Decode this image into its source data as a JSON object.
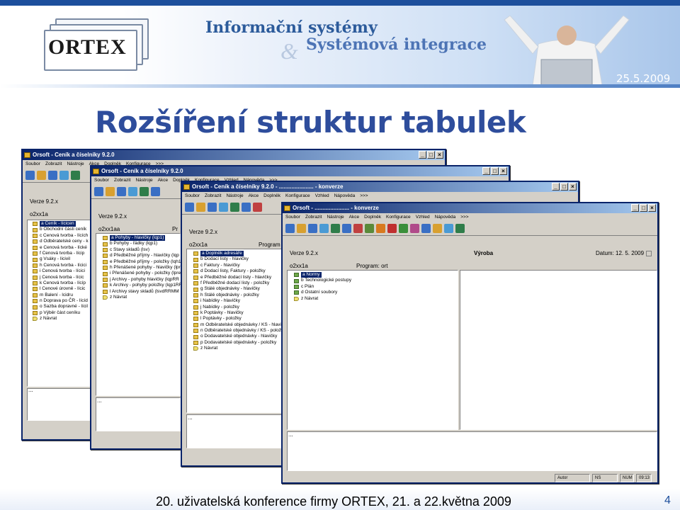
{
  "banner": {
    "logo": "ORTEX",
    "org_line1": "Informační systémy",
    "org_amp": "&",
    "org_line2": "Systémová integrace",
    "date": "25.5.2009"
  },
  "slide": {
    "title": "Rozšíření struktur tabulek",
    "footer": "20. uživatelská konference firmy ORTEX, 21. a 22.května 2009",
    "page_number": "4"
  },
  "colors": {
    "accent": "#2e4d9c",
    "titlebar": "#0a246a",
    "selection": "#0a246a"
  },
  "windows": [
    {
      "title": "Orsoft - Ceník a číselníky 9.2.0",
      "menu": [
        "Soubor",
        "Zobrazit",
        "Nástroje",
        "Akce",
        "Doplněk",
        "Konfigurace",
        ">>>"
      ],
      "version": "Verze 9.2.x",
      "user": "o2xx1a",
      "tree": [
        {
          "text": "a  Ceník - lícicen",
          "selected": true
        },
        {
          "text": "b  Obchodní části ceník"
        },
        {
          "text": "c  Cenová tvorba - lících"
        },
        {
          "text": "d  Odběratelské ceny - k"
        },
        {
          "text": "e  Cenová tvorba - lícké"
        },
        {
          "text": "f  Cenová tvorba - lícip"
        },
        {
          "text": "g  Vsáky - lícivil"
        },
        {
          "text": "h  Cenová tvorba - lícici"
        },
        {
          "text": "i  Cenová tvorba - lícici"
        },
        {
          "text": "j  Cenová tvorba - lícic"
        },
        {
          "text": "k  Cenová tvorba - lícíp"
        },
        {
          "text": "l  Cenové úrovně - lícic"
        },
        {
          "text": "m  Balení - lcidru"
        },
        {
          "text": "n  Doprava po ČR - lícíd"
        },
        {
          "text": "o  Sazba dopravné - lícil"
        },
        {
          "text": "p  Výběr část ceníku"
        },
        {
          "text": "z  Návrat",
          "back": true
        }
      ],
      "dots": "..."
    },
    {
      "title": "Orsoft - Ceník a číselníky 9.2.0",
      "menu": [
        "Soubor",
        "Zobrazit",
        "Nástroje",
        "Akce",
        "Doplněk",
        "Konfigurace",
        "Vzhled",
        "Nápověda",
        ">>>"
      ],
      "version": "Verze 9.2.x",
      "user": "o2xx1aa",
      "label_right": "Pr",
      "tree": [
        {
          "text": "a  Pohyby - hlavičky (lqp1)",
          "selected": true
        },
        {
          "text": "b  Pohyby - řádky (lqp1)"
        },
        {
          "text": "c  Stavy skladů (lsv)"
        },
        {
          "text": "d  Předběžné příjmy - hlavičky (lqp"
        },
        {
          "text": "e  Předběžné příjmy - položky (lqh1"
        },
        {
          "text": "h  Přenášené pohyby - hlavičky (lpr"
        },
        {
          "text": "i  Přenášené pohyby - položky (lpre"
        },
        {
          "text": "j  Archivy - pohyby hlavičky (lqpRR"
        },
        {
          "text": "k  Archivy - pohyby položky (lqp1RR"
        },
        {
          "text": "l  Archivy stavy skladů (lsvdRRMM"
        },
        {
          "text": "z  Návrat",
          "back": true
        }
      ],
      "dots": "..."
    },
    {
      "title": "Orsoft - Ceník a číselníky 9.2.0 - ...................... - konverze",
      "menu": [
        "Soubor",
        "Zobrazit",
        "Nástroje",
        "Akce",
        "Doplněk",
        "Konfigurace",
        "Vzhled",
        "Nápověda",
        ">>>"
      ],
      "version": "Verze 9.2.x",
      "user": "o2xx1a",
      "program": "Program",
      "tree": [
        {
          "text": "a  Doplněk adresáře",
          "selected": true
        },
        {
          "text": "b  Dodací listy - hlavičky"
        },
        {
          "text": "c  Faktury - hlavičky"
        },
        {
          "text": "d  Dodací listy, Faktury - položky"
        },
        {
          "text": "e  Předběžné dodací listy - hlavičky"
        },
        {
          "text": "f  Předběžné dodací listy - položky"
        },
        {
          "text": "g  Stálé objednávky - hlavičky"
        },
        {
          "text": "h  Stálé objednávky - položky"
        },
        {
          "text": "i  Nabídky - hlavičky"
        },
        {
          "text": "j  Nabídky - položky"
        },
        {
          "text": "k  Poptávky - hlavičky"
        },
        {
          "text": "l  Poptávky - položky"
        },
        {
          "text": "m  Odběratelské objednávky / KS - hlavič"
        },
        {
          "text": "n  Odběratelské objednávky / KS - polož"
        },
        {
          "text": "o  Dodavatelské objednávky - hlavičky"
        },
        {
          "text": "p  Dodavatelské objednávky - položky"
        },
        {
          "text": "z  Návrat",
          "back": true
        }
      ],
      "dots": "..."
    },
    {
      "title": "Orsoft - ...................... - konverze",
      "menu": [
        "Soubor",
        "Zobrazit",
        "Nástroje",
        "Akce",
        "Doplněk",
        "Konfigurace",
        "Vzhled",
        "Nápověda",
        ">>>"
      ],
      "version": "Verze 9.2.x",
      "user": "o2xx1a",
      "program": "Program: ort",
      "module": "Výroba",
      "date_label": "Datum: 12. 5. 2009",
      "tree": [
        {
          "text": "a  Normy",
          "selected": true,
          "folder": true
        },
        {
          "text": "b  Technologické postupy",
          "folder": true
        },
        {
          "text": "c  Plán",
          "folder": true
        },
        {
          "text": "d  Ostatní soubory",
          "folder": true
        },
        {
          "text": "z  Návrat",
          "back": true
        }
      ],
      "dots": "...",
      "status": [
        "Autor",
        "NS",
        "NUM",
        "09:13"
      ]
    }
  ]
}
